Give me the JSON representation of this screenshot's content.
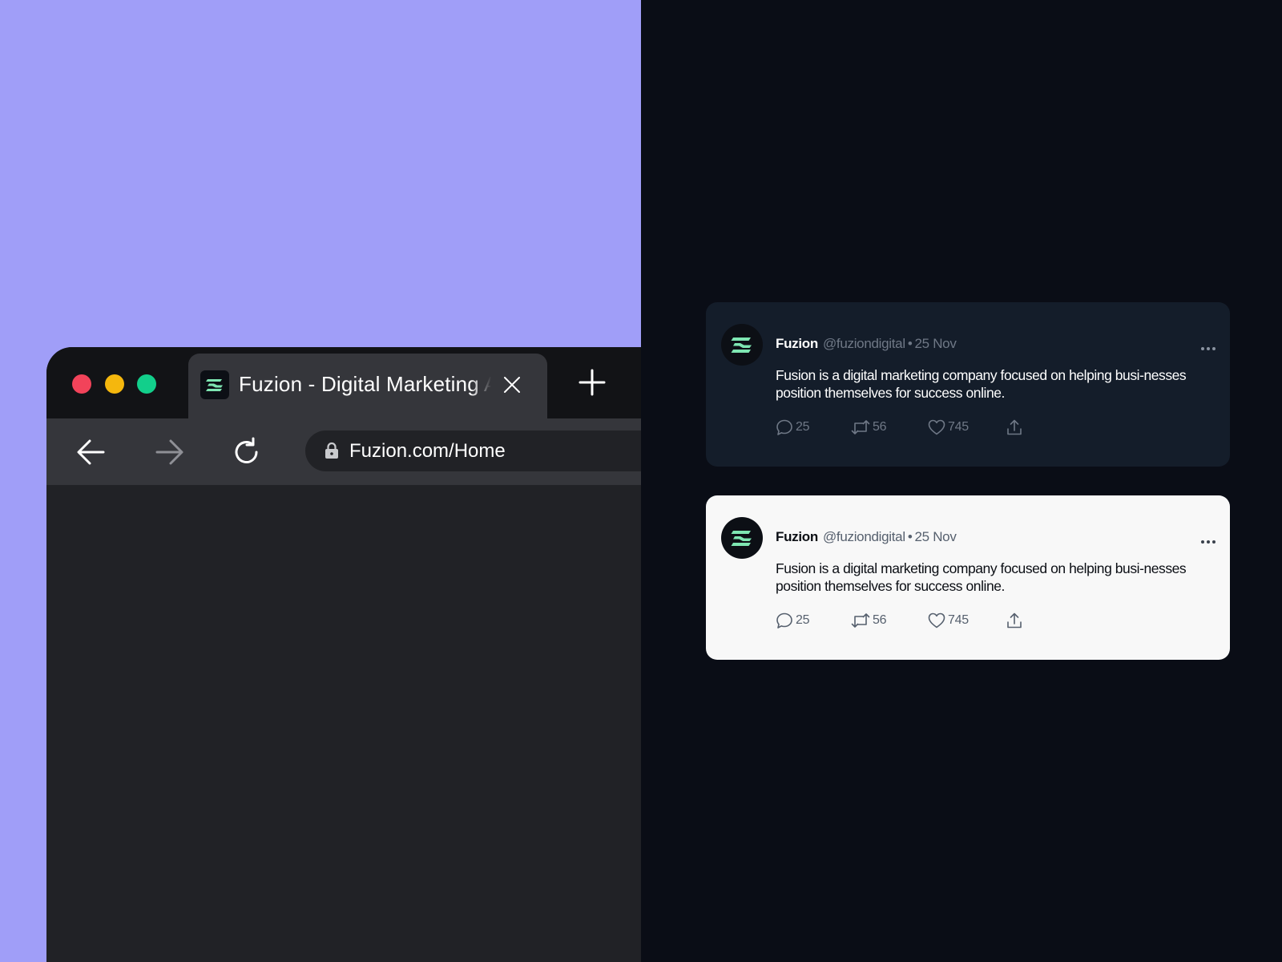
{
  "colors": {
    "left_background": "#a09ef8",
    "right_background": "#0a0d16",
    "traffic_red": "#f2435a",
    "traffic_yellow": "#f5b70d",
    "traffic_green": "#12cf8b",
    "brand_mint": "#7ee6b2"
  },
  "browser": {
    "tab": {
      "favicon": "fuzion-logo-icon",
      "title": "Fuzion - Digital Marketing Agency",
      "close_icon": "close-icon"
    },
    "new_tab_icon": "plus-icon",
    "nav": {
      "back_icon": "arrow-left-icon",
      "forward_icon": "arrow-right-icon",
      "reload_icon": "reload-icon"
    },
    "address_bar": {
      "lock_icon": "lock-icon",
      "url": "Fuzion.com/Home"
    }
  },
  "tweets": [
    {
      "theme": "dark",
      "author": "Fuzion",
      "handle": "@fuziondigital",
      "date": "25 Nov",
      "text": "Fusion is a digital marketing company focused on helping busi-nesses position themselves for success online.",
      "replies": "25",
      "retweets": "56",
      "likes": "745"
    },
    {
      "theme": "light",
      "author": "Fuzion",
      "handle": "@fuziondigital",
      "date": "25 Nov",
      "text": "Fusion is a digital marketing company focused on helping busi-nesses position themselves for success online.",
      "replies": "25",
      "retweets": "56",
      "likes": "745"
    }
  ]
}
